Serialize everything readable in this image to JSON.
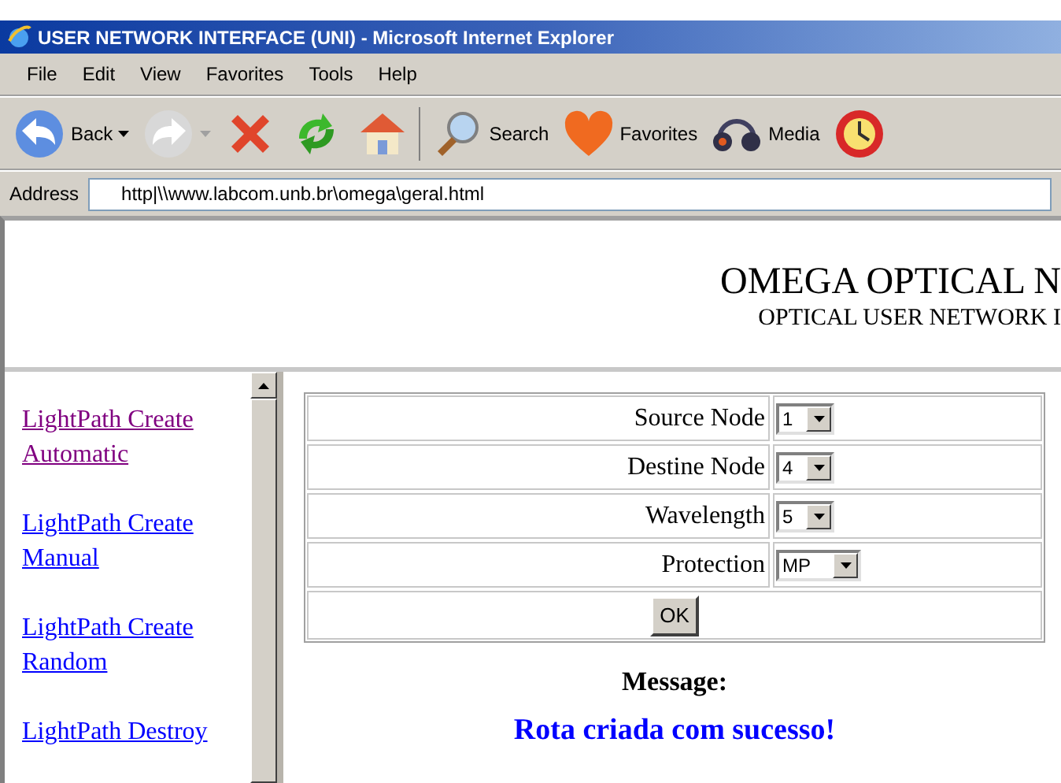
{
  "window": {
    "title": "USER NETWORK INTERFACE (UNI) - Microsoft Internet Explorer"
  },
  "menu": [
    "File",
    "Edit",
    "View",
    "Favorites",
    "Tools",
    "Help"
  ],
  "toolbar": [
    {
      "kind": "back",
      "label": "Back",
      "disabled": false
    },
    {
      "kind": "forward",
      "disabled": true
    },
    {
      "kind": "stop"
    },
    {
      "kind": "refresh"
    },
    {
      "kind": "home"
    },
    {
      "kind": "search",
      "label": "Search"
    },
    {
      "kind": "favorites",
      "label": "Favorites"
    },
    {
      "kind": "media",
      "label": "Media"
    },
    {
      "kind": "history"
    }
  ],
  "address": {
    "label": "Address",
    "value": "http|\\\\www.labcom.unb.br\\omega\\geral.html"
  },
  "header": {
    "title": "OMEGA OPTICAL N",
    "subtitle": "OPTICAL USER NETWORK I"
  },
  "sidebar": {
    "links": [
      {
        "label": "LightPath Create Automatic",
        "visited": true
      },
      {
        "label": "LightPath Create Manual",
        "visited": false
      },
      {
        "label": "LightPath Create Random",
        "visited": false
      },
      {
        "label": "LightPath Destroy",
        "visited": false
      }
    ]
  },
  "form": {
    "fields": [
      {
        "label": "Source Node",
        "value": "1"
      },
      {
        "label": "Destine Node",
        "value": "4"
      },
      {
        "label": "Wavelength",
        "value": "5"
      },
      {
        "label": "Protection",
        "value": "MP"
      }
    ],
    "button": "OK"
  },
  "message": {
    "label": "Message:",
    "text": "Rota criada com sucesso!"
  }
}
